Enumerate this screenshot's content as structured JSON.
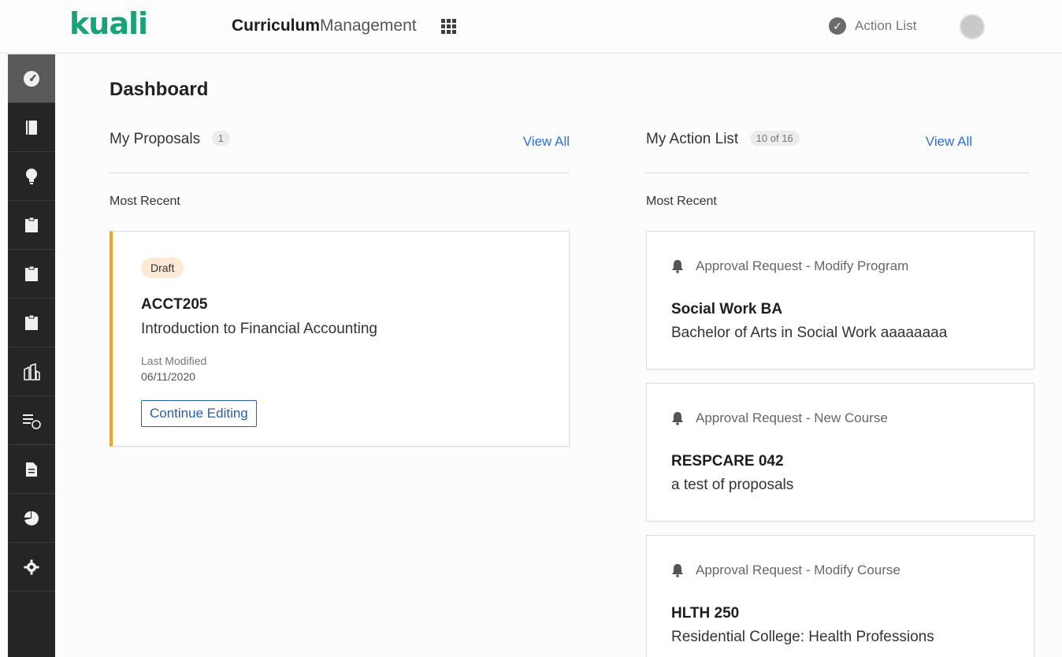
{
  "header": {
    "logo": "kuali",
    "product_bold": "Curriculum",
    "product_rest": "Management",
    "action_list_label": "Action List"
  },
  "sidebar": {
    "items": [
      {
        "icon": "dashboard-gauge-icon",
        "active": true
      },
      {
        "icon": "book-icon"
      },
      {
        "icon": "lightbulb-icon"
      },
      {
        "icon": "clipboard-icon"
      },
      {
        "icon": "clipboard-icon"
      },
      {
        "icon": "clipboard-icon"
      },
      {
        "icon": "institution-icon"
      },
      {
        "icon": "list-clock-icon"
      },
      {
        "icon": "document-icon"
      },
      {
        "icon": "pie-chart-icon"
      },
      {
        "icon": "gear-icon"
      }
    ]
  },
  "main": {
    "title": "Dashboard",
    "proposals": {
      "title": "My Proposals",
      "count": "1",
      "view_all": "View All",
      "subtitle": "Most Recent",
      "card": {
        "status": "Draft",
        "code": "ACCT205",
        "name": "Introduction to Financial Accounting",
        "modified_label": "Last Modified",
        "modified_date": "06/11/2020",
        "continue_label": "Continue Editing"
      }
    },
    "action_list": {
      "title": "My Action List",
      "count": "10 of 16",
      "view_all": "View All",
      "subtitle": "Most Recent",
      "items": [
        {
          "request": "Approval Request - Modify Program",
          "code": "Social Work BA",
          "name": "Bachelor of Arts in Social Work aaaaaaaa"
        },
        {
          "request": "Approval Request - New Course",
          "code": "RESPCARE 042",
          "name": "a test of proposals"
        },
        {
          "request": "Approval Request - Modify Course",
          "code": "HLTH 250",
          "name": "Residential College: Health Professions"
        }
      ]
    }
  }
}
